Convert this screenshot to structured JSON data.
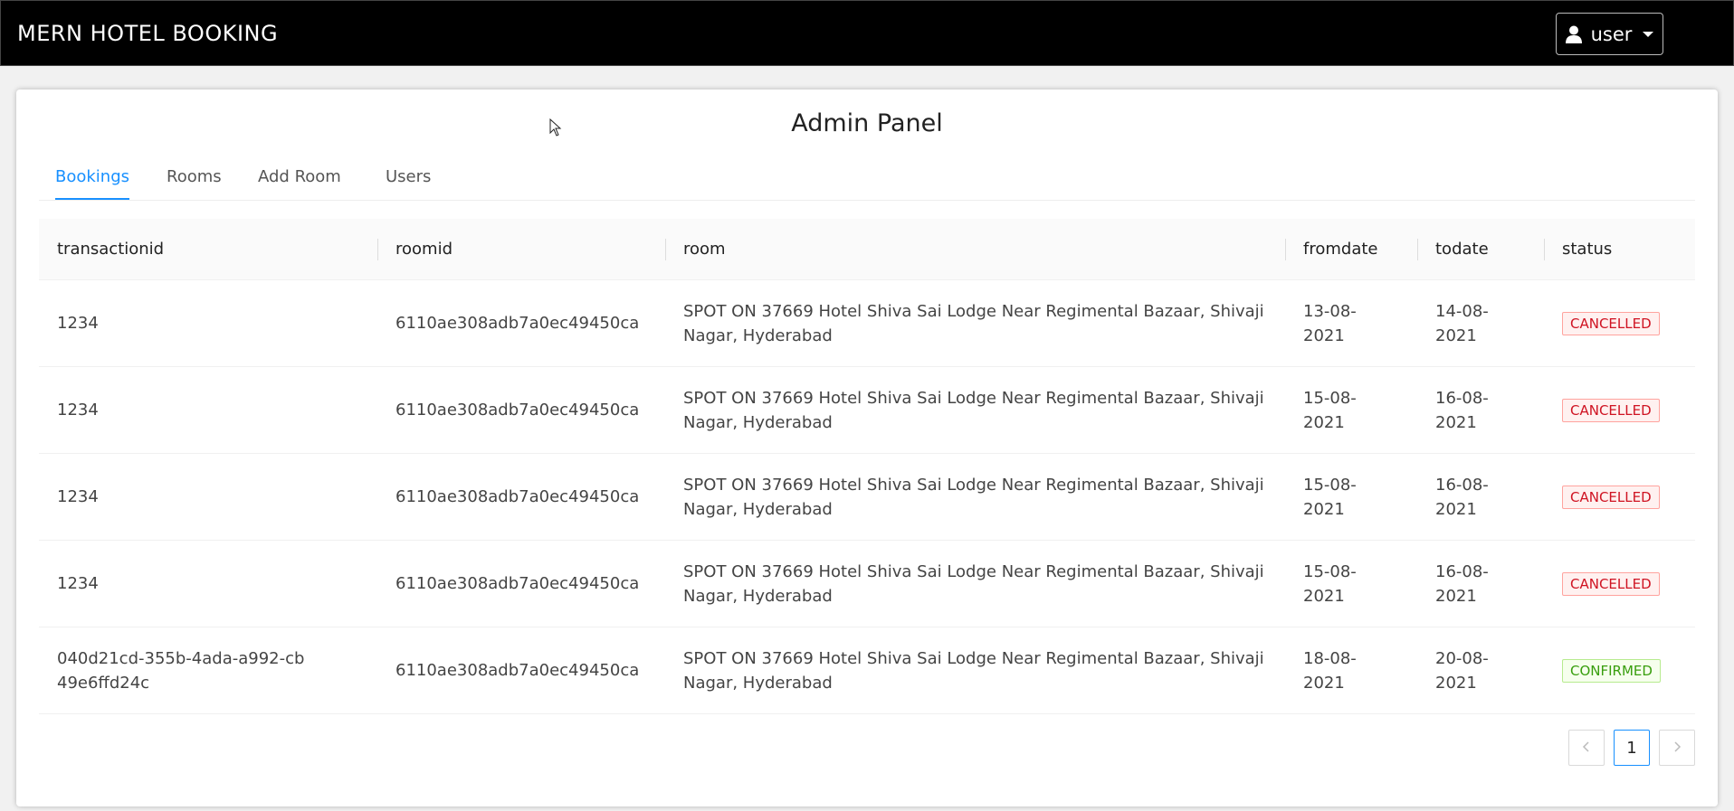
{
  "navbar": {
    "brand": "MERN HOTEL BOOKING",
    "user_label": "user",
    "user_icon": "user-icon"
  },
  "panel": {
    "title": "Admin Panel",
    "tabs": [
      {
        "label": "Bookings",
        "active": true
      },
      {
        "label": "Rooms",
        "active": false
      },
      {
        "label": "Add Room",
        "active": false
      },
      {
        "label": "Users",
        "active": false
      }
    ]
  },
  "table": {
    "columns": [
      "transactionid",
      "roomid",
      "room",
      "fromdate",
      "todate",
      "status"
    ],
    "rows": [
      {
        "transactionid": "1234",
        "roomid": "6110ae308adb7a0ec49450ca",
        "room": "SPOT ON 37669 Hotel Shiva Sai Lodge Near Regimental Bazaar, Shivaji Nagar, Hyderabad",
        "fromdate": "13-08-2021",
        "todate": "14-08-2021",
        "status": "CANCELLED"
      },
      {
        "transactionid": "1234",
        "roomid": "6110ae308adb7a0ec49450ca",
        "room": "SPOT ON 37669 Hotel Shiva Sai Lodge Near Regimental Bazaar, Shivaji Nagar, Hyderabad",
        "fromdate": "15-08-2021",
        "todate": "16-08-2021",
        "status": "CANCELLED"
      },
      {
        "transactionid": "1234",
        "roomid": "6110ae308adb7a0ec49450ca",
        "room": "SPOT ON 37669 Hotel Shiva Sai Lodge Near Regimental Bazaar, Shivaji Nagar, Hyderabad",
        "fromdate": "15-08-2021",
        "todate": "16-08-2021",
        "status": "CANCELLED"
      },
      {
        "transactionid": "1234",
        "roomid": "6110ae308adb7a0ec49450ca",
        "room": "SPOT ON 37669 Hotel Shiva Sai Lodge Near Regimental Bazaar, Shivaji Nagar, Hyderabad",
        "fromdate": "15-08-2021",
        "todate": "16-08-2021",
        "status": "CANCELLED"
      },
      {
        "transactionid": "040d21cd-355b-4ada-a992-cb49e6ffd24c",
        "roomid": "6110ae308adb7a0ec49450ca",
        "room": "SPOT ON 37669 Hotel Shiva Sai Lodge Near Regimental Bazaar, Shivaji Nagar, Hyderabad",
        "fromdate": "18-08-2021",
        "todate": "20-08-2021",
        "status": "CONFIRMED"
      }
    ]
  },
  "pagination": {
    "prev_icon": "chevron-left-icon",
    "current_page": "1",
    "next_icon": "chevron-right-icon"
  },
  "colors": {
    "accent": "#1890ff",
    "cancelled": "#cf1322",
    "confirmed": "#389e0d"
  }
}
